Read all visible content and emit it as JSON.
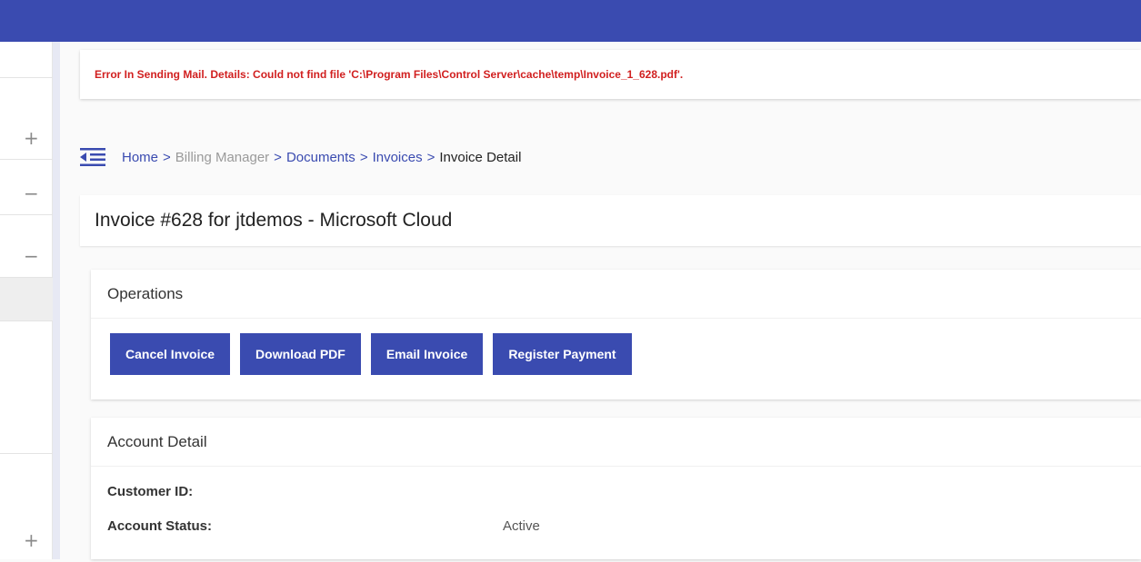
{
  "app": {
    "accent": "#3a4bb0",
    "error_color": "#d11f1f"
  },
  "sidebar": {
    "rows": [
      {
        "icon": "plus-icon",
        "glyph": "+"
      },
      {
        "icon": "minus-icon",
        "glyph": "−"
      },
      {
        "icon": "minus-icon",
        "glyph": "−"
      },
      {
        "icon": "",
        "glyph": ""
      },
      {
        "icon": "plus-icon",
        "glyph": "+"
      }
    ]
  },
  "error": {
    "message": "Error In Sending Mail. Details: Could not find file 'C:\\Program Files\\Control Server\\cache\\temp\\Invoice_1_628.pdf'."
  },
  "breadcrumb": {
    "icon": "menu-collapse-icon",
    "items": [
      "Home",
      "Billing Manager",
      "Documents",
      "Invoices",
      "Invoice Detail"
    ],
    "separator": ">"
  },
  "page": {
    "title": "Invoice #628 for jtdemos - Microsoft Cloud"
  },
  "operations": {
    "title": "Operations",
    "buttons": [
      "Cancel Invoice",
      "Download PDF",
      "Email Invoice",
      "Register Payment"
    ]
  },
  "account_detail": {
    "title": "Account Detail",
    "rows": [
      {
        "label": "Customer ID:",
        "value": ""
      },
      {
        "label": "Account Status:",
        "value": "Active"
      }
    ]
  }
}
